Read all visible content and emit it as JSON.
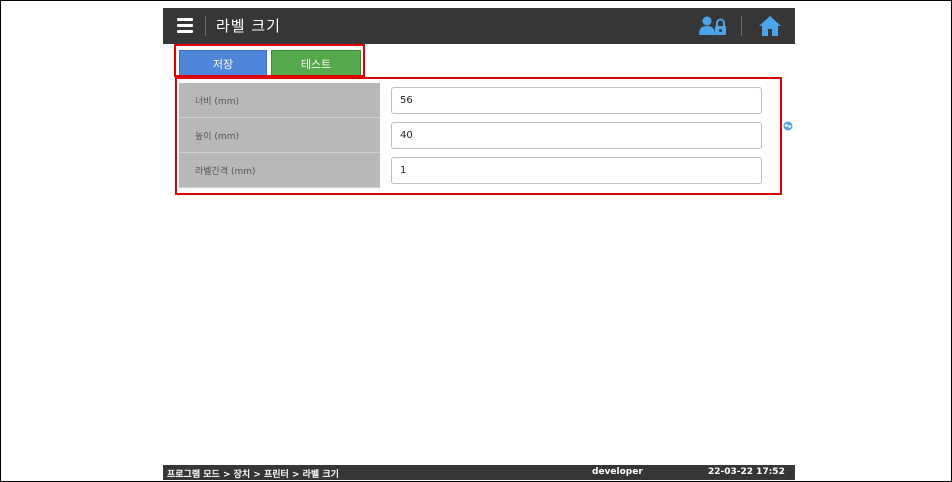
{
  "header": {
    "title": "라벨 크기",
    "menu_icon": "hamburger-menu-icon",
    "user_icon": "user-lock-icon",
    "home_icon": "home-icon"
  },
  "toolbar": {
    "save_label": "저장",
    "test_label": "테스트"
  },
  "form": {
    "rows": [
      {
        "label": "너비 (mm)",
        "value": "56"
      },
      {
        "label": "높이 (mm)",
        "value": "40"
      },
      {
        "label": "라벨간격 (mm)",
        "value": "1"
      }
    ]
  },
  "status": {
    "breadcrumb": "프로그램 모드 > 장치 > 프린터 > 라벨 크기",
    "user": "developer",
    "datetime": "22-03-22 17:52"
  },
  "colors": {
    "topbar": "#363636",
    "save_button": "#4f86d9",
    "test_button": "#55a84c",
    "highlight_border": "#e00000",
    "label_cell": "#b8b8b8"
  }
}
